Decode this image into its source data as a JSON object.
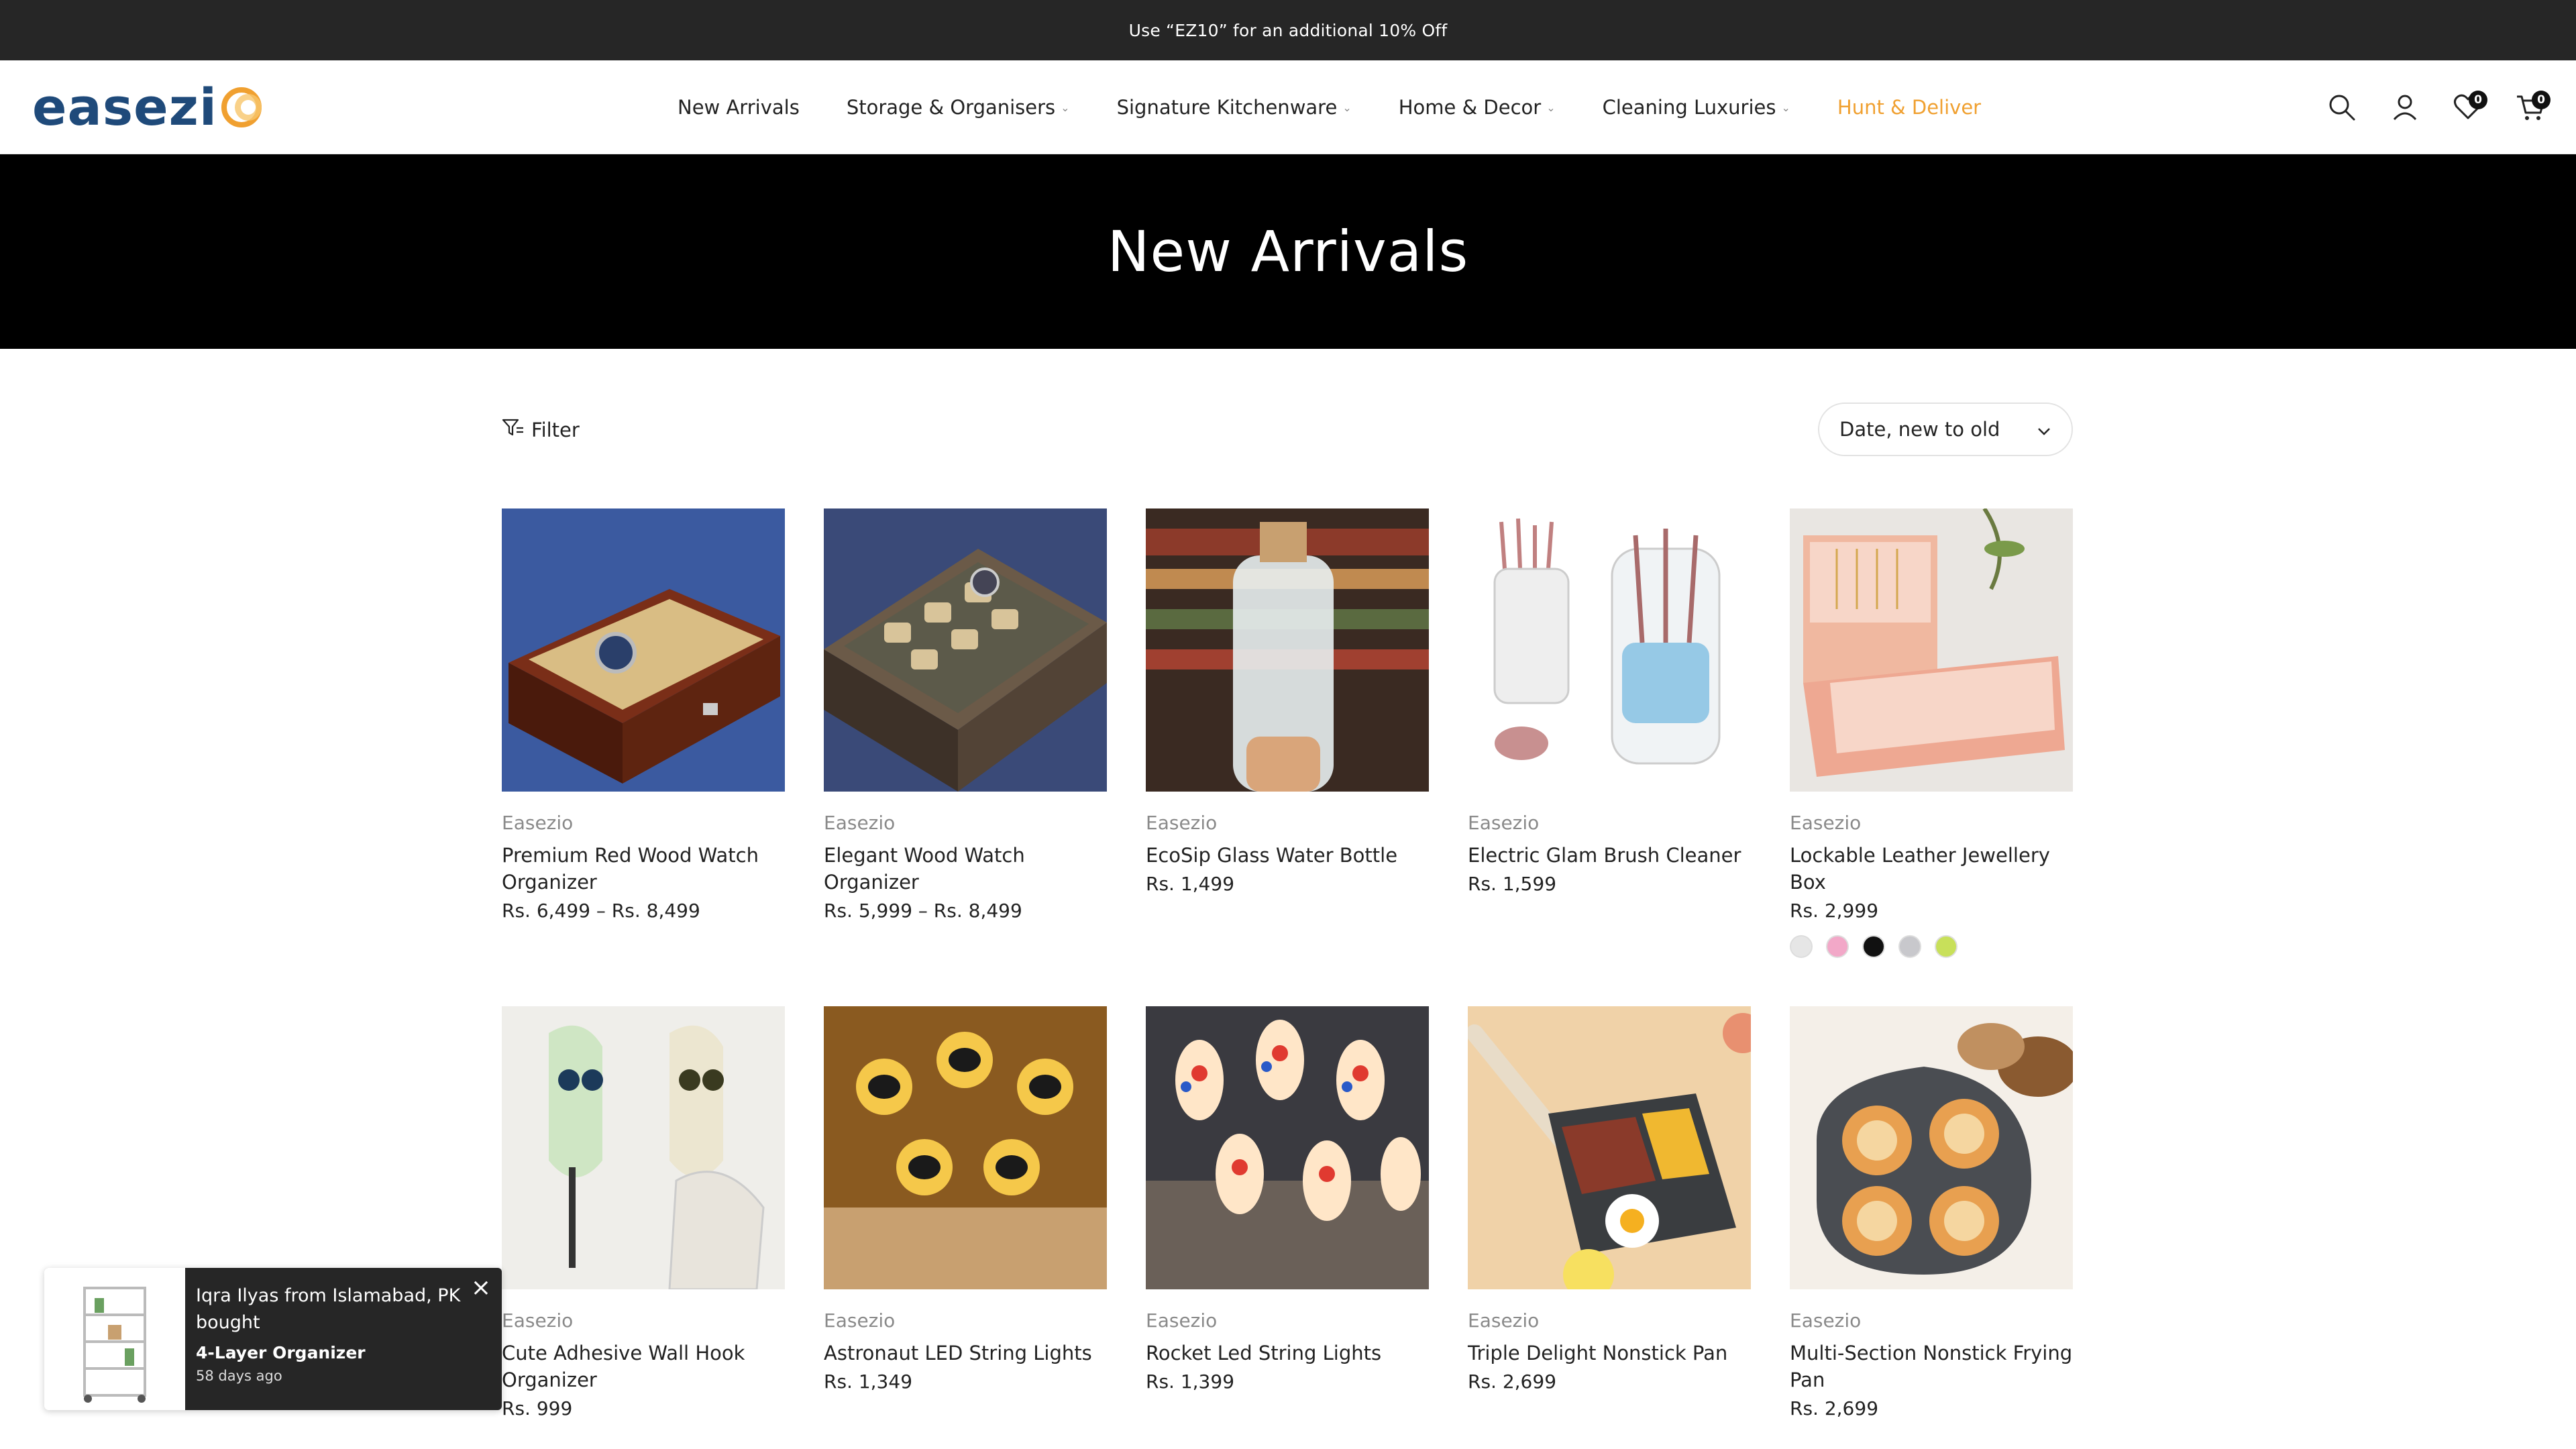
{
  "announcement": {
    "text": "Use “EZ10” for an additional 10% Off"
  },
  "brand": {
    "name": "easezi"
  },
  "nav": {
    "items": [
      {
        "label": "New Arrivals",
        "has_dropdown": false
      },
      {
        "label": "Storage & Organisers",
        "has_dropdown": true
      },
      {
        "label": "Signature Kitchenware",
        "has_dropdown": true
      },
      {
        "label": "Home & Decor",
        "has_dropdown": true
      },
      {
        "label": "Cleaning Luxuries",
        "has_dropdown": true
      },
      {
        "label": "Hunt & Deliver",
        "has_dropdown": false,
        "accent": "#f0a030"
      }
    ]
  },
  "header_icons": {
    "wishlist_count": "0",
    "cart_count": "0"
  },
  "page": {
    "title": "New Arrivals"
  },
  "toolbar": {
    "filter_label": "Filter",
    "sort_value": "Date, new to old"
  },
  "products": [
    {
      "vendor": "Easezio",
      "name": "Premium Red Wood Watch Organizer",
      "price": "Rs. 6,499 – Rs. 8,499"
    },
    {
      "vendor": "Easezio",
      "name": "Elegant Wood Watch Organizer",
      "price": "Rs. 5,999 – Rs. 8,499"
    },
    {
      "vendor": "Easezio",
      "name": "EcoSip Glass Water Bottle",
      "price": "Rs. 1,499"
    },
    {
      "vendor": "Easezio",
      "name": "Electric Glam Brush Cleaner",
      "price": "Rs. 1,599"
    },
    {
      "vendor": "Easezio",
      "name": "Lockable Leather Jewellery Box",
      "price": "Rs. 2,999",
      "swatches": [
        "#e6e6e6",
        "#f2a8c8",
        "#111111",
        "#c8c8cc",
        "#c8e05a"
      ]
    },
    {
      "vendor": "Easezio",
      "name": "Cute Adhesive Wall Hook Organizer",
      "price": "Rs. 999"
    },
    {
      "vendor": "Easezio",
      "name": "Astronaut LED String Lights",
      "price": "Rs. 1,349"
    },
    {
      "vendor": "Easezio",
      "name": "Rocket Led String Lights",
      "price": "Rs. 1,399"
    },
    {
      "vendor": "Easezio",
      "name": "Triple Delight Nonstick Pan",
      "price": "Rs. 2,699"
    },
    {
      "vendor": "Easezio",
      "name": "Multi-Section Nonstick Frying Pan",
      "price": "Rs. 2,699"
    }
  ],
  "toast": {
    "message": "Iqra Ilyas from Islamabad, PK bought",
    "product": "4-Layer Organizer",
    "time": "58 days ago"
  }
}
